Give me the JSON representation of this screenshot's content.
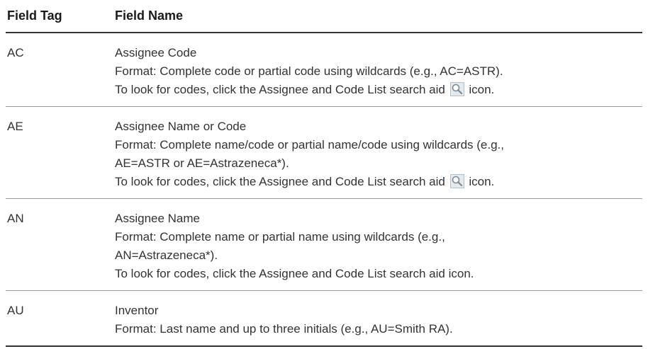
{
  "header": {
    "field_tag": "Field Tag",
    "field_name": "Field Name"
  },
  "rows": [
    {
      "tag": "AC",
      "title": "Assignee Code",
      "lines": [
        "Format: Complete code or partial code using wildcards (e.g., AC=ASTR)."
      ],
      "lookup_before": "To look for codes, click the Assignee and Code List search aid",
      "lookup_after": "icon.",
      "icon": "search-aid-icon"
    },
    {
      "tag": "AE",
      "title": "Assignee Name or Code",
      "lines": [
        "Format: Complete name/code or partial name/code using wildcards (e.g.,",
        "AE=ASTR or AE=Astrazeneca*)."
      ],
      "lookup_before": "To look for codes, click the Assignee and Code List search aid",
      "lookup_after": "icon.",
      "icon": "search-aid-icon"
    },
    {
      "tag": "AN",
      "title": "Assignee Name",
      "lines": [
        "Format: Complete name or partial name using wildcards (e.g.,",
        "AN=Astrazeneca*).",
        "To look for codes, click the Assignee and Code List search aid icon."
      ]
    },
    {
      "tag": "AU",
      "title": "Inventor",
      "lines": [
        "Format: Last name and up to three initials (e.g., AU=Smith RA)."
      ]
    }
  ]
}
